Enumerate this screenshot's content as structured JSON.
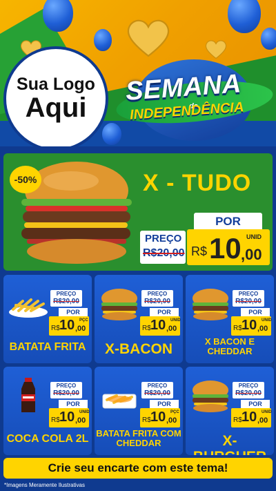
{
  "header": {
    "logo_line1": "Sua Logo",
    "logo_line2": "Aqui",
    "title_main": "SEMANA",
    "title_da": "da",
    "title_sub": "INDEPENDÊNCIA"
  },
  "featured": {
    "discount": "-50%",
    "name": "X - TUDO",
    "preco_label": "PREÇO",
    "old_price": "R$20,00",
    "por_label": "POR",
    "currency": "R$",
    "price_int": "10",
    "price_dec": ",00",
    "unit": "UNID"
  },
  "products": [
    {
      "name": "BATATA FRITA",
      "preco_label": "PREÇO",
      "old_price": "R$20,00",
      "por_label": "POR",
      "currency": "R$",
      "price_int": "10",
      "price_dec": ",00",
      "unit": "PÇC",
      "icon": "fries-icon"
    },
    {
      "name": "X-BACON",
      "preco_label": "PREÇO",
      "old_price": "R$20,00",
      "por_label": "POR",
      "currency": "R$",
      "price_int": "10",
      "price_dec": ",00",
      "unit": "UNID",
      "icon": "burger-icon"
    },
    {
      "name": "X BACON E CHEDDAR",
      "preco_label": "PREÇO",
      "old_price": "R$20,00",
      "por_label": "POR",
      "currency": "R$",
      "price_int": "10",
      "price_dec": ",00",
      "unit": "UNID",
      "icon": "burger-icon"
    },
    {
      "name": "COCA COLA 2L",
      "preco_label": "PREÇO",
      "old_price": "R$20,00",
      "por_label": "POR",
      "currency": "R$",
      "price_int": "10",
      "price_dec": ",00",
      "unit": "UNID",
      "icon": "soda-bottle-icon"
    },
    {
      "name": "BATATA FRITA COM CHEDDAR",
      "preco_label": "PREÇO",
      "old_price": "R$20,00",
      "por_label": "POR",
      "currency": "R$",
      "price_int": "10",
      "price_dec": ",00",
      "unit": "PÇC",
      "icon": "fries-cheddar-icon"
    },
    {
      "name": "X-BURGUER",
      "preco_label": "PREÇO",
      "old_price": "R$20,00",
      "por_label": "POR",
      "currency": "R$",
      "price_int": "10",
      "price_dec": ",00",
      "unit": "UNID",
      "icon": "burger-icon"
    }
  ],
  "footer": {
    "cta": "Crie seu encarte com este tema!",
    "disclaimer": "*Imagens Meramente Ilustrativas"
  },
  "colors": {
    "brand_blue": "#0f3a8f",
    "card_blue": "#1f5fd6",
    "featured_green": "#2a8f2e",
    "accent_yellow": "#ffd400",
    "strike_red": "#d21e1e"
  }
}
